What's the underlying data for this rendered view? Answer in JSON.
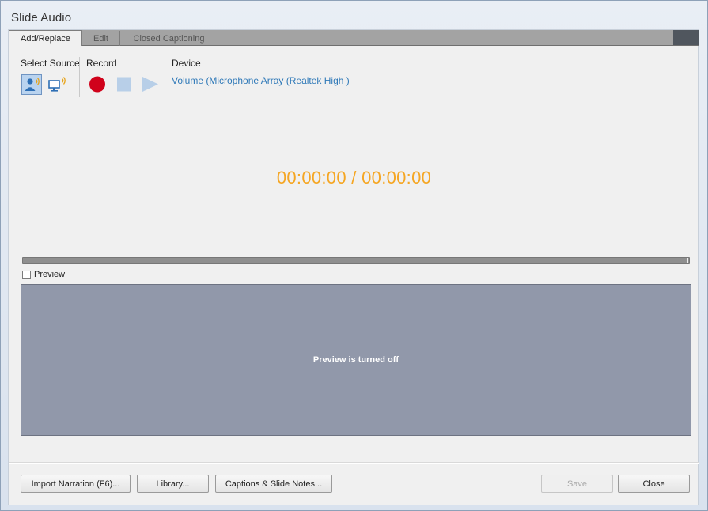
{
  "window": {
    "title": "Slide Audio"
  },
  "tabs": [
    {
      "label": "Add/Replace",
      "active": true
    },
    {
      "label": "Edit",
      "active": false
    },
    {
      "label": "Closed Captioning",
      "active": false
    }
  ],
  "toolbar": {
    "select_source_label": "Select Source",
    "record_label": "Record",
    "device_label": "Device",
    "device_value": "Volume (Microphone Array (Realtek High )",
    "source_icons": [
      "microphone-person-icon",
      "computer-audio-icon"
    ],
    "record_icons": [
      "record-icon",
      "stop-icon",
      "play-icon"
    ]
  },
  "timer": {
    "text": "00:00:00 / 00:00:00",
    "color": "#f5a623"
  },
  "preview": {
    "checkbox_label": "Preview",
    "checked": false,
    "message": "Preview is turned off"
  },
  "footer": {
    "import_label": "Import Narration (F6)...",
    "library_label": "Library...",
    "captions_label": "Captions & Slide Notes...",
    "save_label": "Save",
    "close_label": "Close"
  },
  "colors": {
    "record_red": "#d0021b",
    "disabled_blue": "#b8cfe8",
    "link_blue": "#2f79b8",
    "preview_bg": "#9198aa"
  }
}
